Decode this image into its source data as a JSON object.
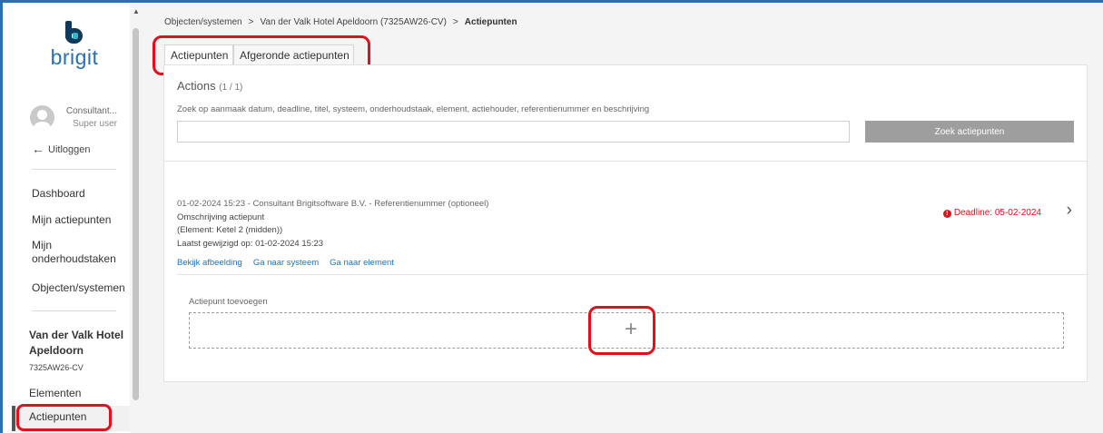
{
  "app": {
    "logo_text": "brigit"
  },
  "user": {
    "name": "Consultant...",
    "role": "Super user"
  },
  "logout_label": "Uitloggen",
  "nav": [
    {
      "label": "Dashboard"
    },
    {
      "label": "Mijn actiepunten"
    },
    {
      "label": "Mijn onderhoudstaken"
    },
    {
      "label": "Objecten/systemen"
    }
  ],
  "project": {
    "name": "Van der Valk Hotel Apeldoorn",
    "code": "7325AW26-CV"
  },
  "subnav": [
    {
      "label": "Elementen"
    },
    {
      "label": "Actiepunten"
    }
  ],
  "breadcrumb": {
    "items": [
      "Objecten/systemen",
      "Van der Valk Hotel Apeldoorn (7325AW26-CV)",
      "Actiepunten"
    ],
    "separator": ">"
  },
  "tabs": [
    {
      "label": "Actiepunten",
      "active": true
    },
    {
      "label": "Afgeronde actiepunten",
      "active": false
    }
  ],
  "card": {
    "title": "Actions",
    "count": "(1 / 1)",
    "search_label": "Zoek op aanmaak datum, deadline, titel, systeem, onderhoudstaak, element, actiehouder, referentienummer en beschrijving",
    "search_value": "",
    "search_button": "Zoek actiepunten"
  },
  "action": {
    "meta": "01-02-2024 15:23 - Consultant Brigitsoftware B.V. - Referentienummer (optioneel)",
    "description": "Omschrijving actiepunt",
    "element": "(Element: Ketel 2 (midden))",
    "modified": "Laatst gewijzigd op: 01-02-2024 15:23",
    "links": [
      "Bekijk afbeelding",
      "Ga naar systeem",
      "Ga naar element"
    ],
    "deadline": "Deadline: 05-02-2024"
  },
  "add": {
    "label": "Actiepunt toevoegen",
    "plus": "+"
  },
  "colors": {
    "brand_dark": "#0f3a5c",
    "brand_blue": "#2a6fb0",
    "brand_teal": "#38b6c9",
    "highlight": "#e0101c",
    "link": "#1a73c6"
  }
}
